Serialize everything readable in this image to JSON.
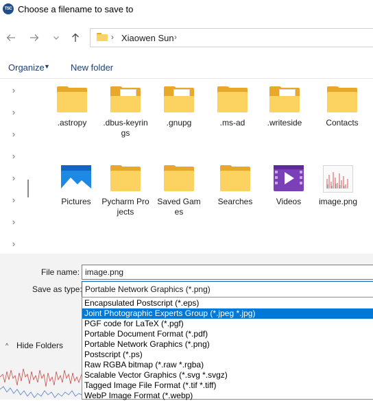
{
  "window": {
    "title": "Choose a filename to save to",
    "app_icon": "tsc-logo-icon"
  },
  "nav": {
    "back": "arrow-left-icon",
    "forward": "arrow-right-icon",
    "recent": "chevron-down-icon",
    "up": "arrow-up-icon"
  },
  "address": {
    "separator": "›",
    "path": "Xiaowen Sun"
  },
  "toolbar": {
    "organize": "Organize",
    "new_folder": "New folder"
  },
  "left_pane": {
    "chevron": "›"
  },
  "items": [
    {
      "label": ".astropy",
      "icon": "folder-icon"
    },
    {
      "label": ".dbus-keyrings",
      "icon": "folder-icon"
    },
    {
      "label": ".gnupg",
      "icon": "folder-icon"
    },
    {
      "label": ".ms-ad",
      "icon": "folder-icon"
    },
    {
      "label": ".writeside",
      "icon": "folder-icon"
    },
    {
      "label": "Contacts",
      "icon": "folder-icon"
    },
    {
      "label": "Pictures",
      "icon": "pictures-folder-icon"
    },
    {
      "label": "Pycharm Projects",
      "icon": "folder-icon"
    },
    {
      "label": "Saved Games",
      "icon": "folder-icon"
    },
    {
      "label": "Searches",
      "icon": "folder-icon"
    },
    {
      "label": "Videos",
      "icon": "videos-folder-icon"
    },
    {
      "label": "image.png",
      "icon": "image-file-icon"
    }
  ],
  "form": {
    "file_name_label": "File name:",
    "file_name_value": "image.png",
    "save_as_type_label": "Save as type:",
    "save_as_type_value": "Portable Network Graphics (*.png)"
  },
  "dropdown": {
    "options": [
      "Encapsulated Postscript (*.eps)",
      "Joint Photographic Experts Group (*.jpeg *.jpg)",
      "PGF code for LaTeX (*.pgf)",
      "Portable Document Format (*.pdf)",
      "Portable Network Graphics (*.png)",
      "Postscript (*.ps)",
      "Raw RGBA bitmap (*.raw *.rgba)",
      "Scalable Vector Graphics (*.svg *.svgz)",
      "Tagged Image File Format (*.tif *.tiff)",
      "WebP Image Format (*.webp)"
    ],
    "highlighted_index": 1
  },
  "footer": {
    "hide_folders": "Hide Folders",
    "caret": "^"
  },
  "colors": {
    "accent": "#0078d7",
    "folder": "#fcd261",
    "folder_back": "#e8a82a",
    "link": "#1b3f73"
  }
}
